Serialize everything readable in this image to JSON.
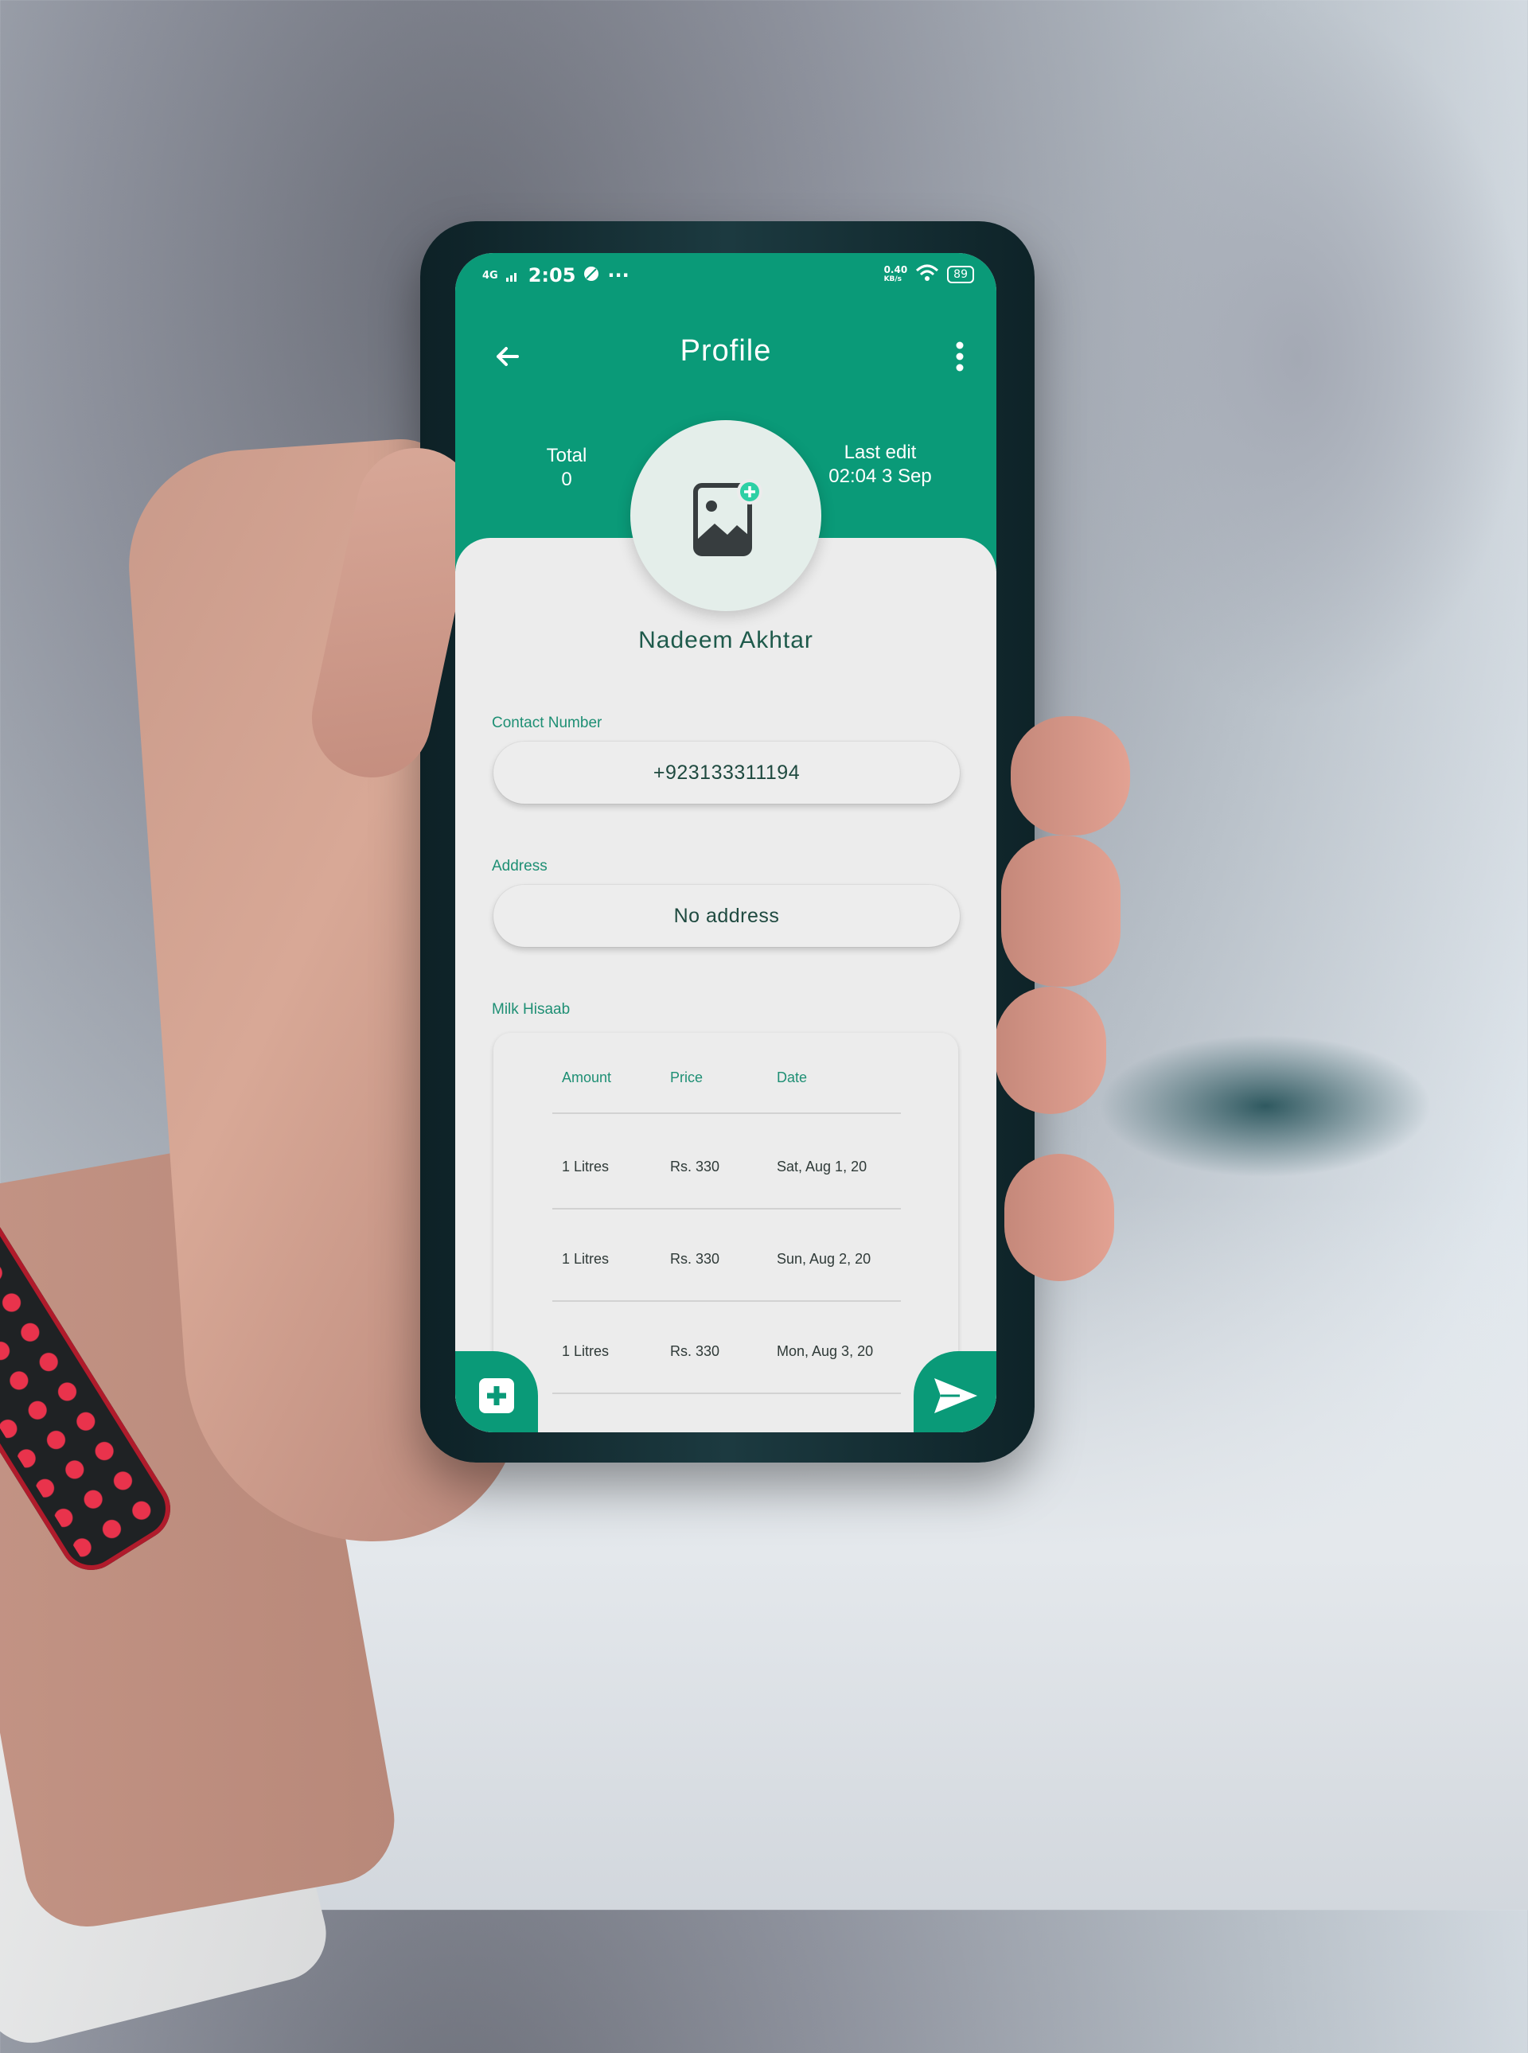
{
  "status_bar": {
    "network": "4G",
    "time": "2:05",
    "speed": "0.40",
    "speed_unit": "KB/s",
    "battery": "89"
  },
  "app_bar": {
    "title": "Profile"
  },
  "stats": {
    "total_label": "Total",
    "total_value": "0",
    "last_edit_label": "Last edit",
    "last_edit_value": "02:04 3 Sep"
  },
  "profile": {
    "name": "Nadeem Akhtar"
  },
  "contact": {
    "label": "Contact Number",
    "value": "+923133311194"
  },
  "address": {
    "label": "Address",
    "value": "No address"
  },
  "milk_hisaab": {
    "label": "Milk Hisaab",
    "columns": [
      "Amount",
      "Price",
      "Date"
    ],
    "rows": [
      [
        "1 Litres",
        "Rs. 330",
        "Sat, Aug 1, 20"
      ],
      [
        "1 Litres",
        "Rs. 330",
        "Sun, Aug 2, 20"
      ],
      [
        "1 Litres",
        "Rs. 330",
        "Mon, Aug 3, 20"
      ]
    ]
  },
  "icons": {
    "back": "arrow-left-icon",
    "menu": "more-vertical-icon",
    "avatar": "add-photo-icon",
    "add": "medical-plus-icon",
    "send": "send-icon"
  },
  "colors": {
    "primary": "#0a9a78",
    "accent": "#2ed0a5",
    "text_dark": "#1e5a4b"
  }
}
